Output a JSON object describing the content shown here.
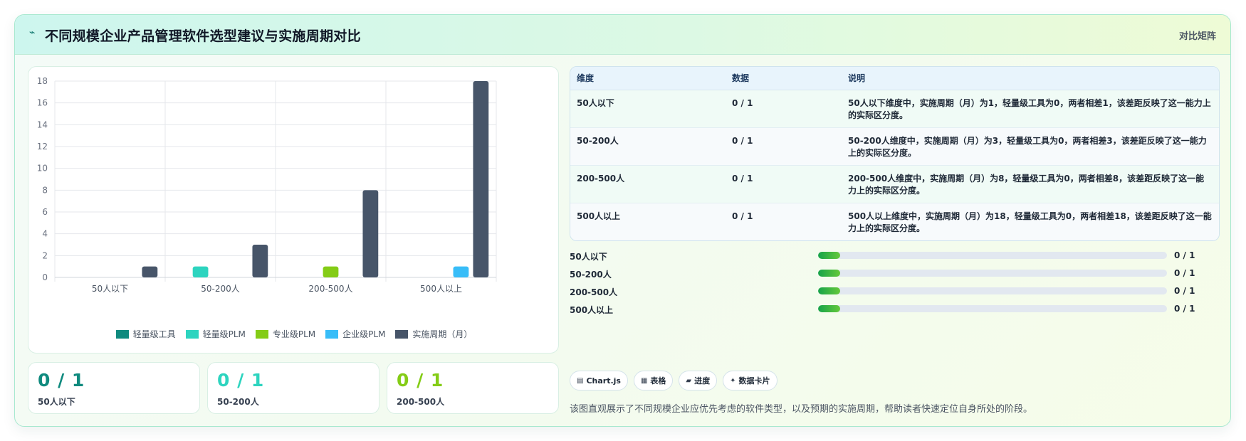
{
  "header": {
    "icon": "chart-icon",
    "title": "不同规模企业产品管理软件选型建议与实施周期对比",
    "tag": "对比矩阵"
  },
  "chart_data": {
    "type": "bar",
    "categories": [
      "50人以下",
      "50-200人",
      "200-500人",
      "500人以上"
    ],
    "series": [
      {
        "name": "轻量级工具",
        "color": "#0f8a7e",
        "values": [
          0,
          0,
          0,
          0
        ]
      },
      {
        "name": "轻量级PLM",
        "color": "#2dd4bf",
        "values": [
          0,
          1,
          0,
          0
        ]
      },
      {
        "name": "专业级PLM",
        "color": "#84cc16",
        "values": [
          0,
          0,
          1,
          0
        ]
      },
      {
        "name": "企业级PLM",
        "color": "#38bdf8",
        "values": [
          0,
          0,
          0,
          1
        ]
      },
      {
        "name": "实施周期（月）",
        "color": "#475569",
        "values": [
          1,
          3,
          8,
          18
        ]
      }
    ],
    "ylim": [
      0,
      18
    ],
    "yticks": [
      0,
      2,
      4,
      6,
      8,
      10,
      12,
      14,
      16,
      18
    ],
    "grid": true,
    "legend": "bottom"
  },
  "stats": [
    {
      "value": "0 / 1",
      "label": "50人以下",
      "color": "#0f8a7e"
    },
    {
      "value": "0 / 1",
      "label": "50-200人",
      "color": "#2dd4bf"
    },
    {
      "value": "0 / 1",
      "label": "200-500人",
      "color": "#84cc16"
    }
  ],
  "table": {
    "headers": [
      "维度",
      "数据",
      "说明"
    ],
    "rows": [
      {
        "dim": "50人以下",
        "data": "0 / 1",
        "desc": "50人以下维度中，实施周期（月）为1，轻量级工具为0，两者相差1，该差距反映了这一能力上的实际区分度。"
      },
      {
        "dim": "50-200人",
        "data": "0 / 1",
        "desc": "50-200人维度中，实施周期（月）为3，轻量级工具为0，两者相差3，该差距反映了这一能力上的实际区分度。"
      },
      {
        "dim": "200-500人",
        "data": "0 / 1",
        "desc": "200-500人维度中，实施周期（月）为8，轻量级工具为0，两者相差8，该差距反映了这一能力上的实际区分度。"
      },
      {
        "dim": "500人以上",
        "data": "0 / 1",
        "desc": "500人以上维度中，实施周期（月）为18，轻量级工具为0，两者相差18，该差距反映了这一能力上的实际区分度。"
      }
    ]
  },
  "progress": [
    {
      "label": "50人以下",
      "value": "0 / 1",
      "fraction": 0
    },
    {
      "label": "50-200人",
      "value": "0 / 1",
      "fraction": 0
    },
    {
      "label": "200-500人",
      "value": "0 / 1",
      "fraction": 0
    },
    {
      "label": "500人以上",
      "value": "0 / 1",
      "fraction": 0
    }
  ],
  "chips": [
    {
      "icon": "chart-icon",
      "glyph": "▤",
      "label": "Chart.js"
    },
    {
      "icon": "table-icon",
      "glyph": "▦",
      "label": "表格"
    },
    {
      "icon": "progress-icon",
      "glyph": "▰",
      "label": "进度"
    },
    {
      "icon": "card-icon",
      "glyph": "✦",
      "label": "数据卡片"
    }
  ],
  "description": "该图直观展示了不同规模企业应优先考虑的软件类型，以及预期的实施周期，帮助读者快速定位自身所处的阶段。"
}
